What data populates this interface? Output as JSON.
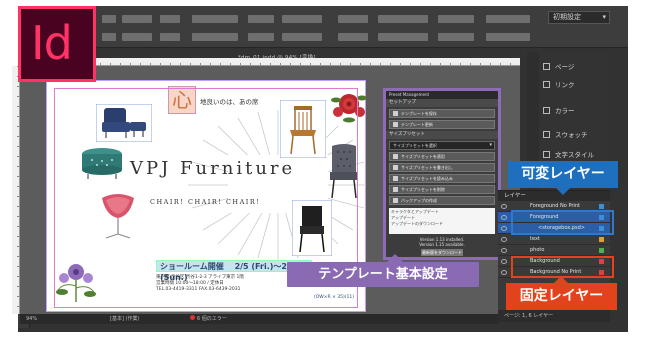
{
  "app": {
    "logo_text": "Id",
    "workspace": "初期設定",
    "doc_tab": "*dm_01.indd @ 94% [変換]",
    "colors": {
      "indesign_pink": "#ff3366",
      "indesign_dark": "#49021f",
      "template_purple": "#8a6bb3",
      "variable_blue": "#1f6fbf",
      "fixed_red": "#e2421c"
    }
  },
  "document": {
    "kokoro": "心",
    "catch_copy": "地良いのは、あの席",
    "heading": "VPJ Furniture",
    "sub_heading": "CHAIR! CHAIR! CHAIR!",
    "showroom_text": "ショールーム開催",
    "showroom_date": "2/5 (Fri.)～2/7 (Sun.)",
    "address_lines": [
      "東京都 渋谷区 渋谷1-2-3 アライブ東京 1階",
      "営業時間 10:00～18:00 / 定休日",
      "TEL.03-4419-3311 FAX.03-6439-2031"
    ],
    "price_note": "(OW×R × 35)(11)"
  },
  "script_panel": {
    "title": "Preset Management",
    "header": "セットアップ",
    "btn_open": "テンプレートを保存",
    "btn_save": "テンプレート更新",
    "section_label": "サイズプリセット",
    "select_value": "サイズプリセットを選択",
    "buttons": [
      "サイズプリセットを適用",
      "サイズプリセットを書き出し",
      "サイズプリセットを読み込み",
      "サイズプリセットを削除",
      "バックアップの作成"
    ],
    "log_lines": [
      "キャラクタとアップデート",
      "アップデート",
      "アップデートのダウンロード"
    ],
    "version_installed": "Version 1.13 installed.",
    "version_available": "Version 1.15 available.",
    "download_label": "最新版をダウンロード"
  },
  "dock": {
    "items": [
      "ページ",
      "リンク",
      "カラー",
      "スウォッチ",
      "文字スタイル"
    ]
  },
  "layers": {
    "title": "レイヤー",
    "rows": [
      {
        "name": "Foreground No Print",
        "sub": false,
        "highlight": false,
        "chip": "#3a8fd8"
      },
      {
        "name": "Foreground",
        "sub": false,
        "highlight": true,
        "chip": "#3a8fd8"
      },
      {
        "name": "<storagebox.psd>",
        "sub": true,
        "highlight": true,
        "chip": "#3a8fd8"
      },
      {
        "name": "text",
        "sub": false,
        "highlight": false,
        "chip": "#e0a030"
      },
      {
        "name": "photo",
        "sub": false,
        "highlight": false,
        "chip": "#50b050"
      },
      {
        "name": "Background",
        "sub": false,
        "highlight": false,
        "chip": "#e04040"
      },
      {
        "name": "Background No Print",
        "sub": false,
        "highlight": false,
        "chip": "#e04040"
      }
    ],
    "footer": "ページ: 1, 6 レイヤー"
  },
  "status": {
    "zoom": "94%",
    "preset": "[基本] (作業)",
    "errors": "6 個のエラー"
  },
  "callouts": {
    "template": "テンプレート基本設定",
    "variable": "可変レイヤー",
    "fixed": "固定レイヤー"
  }
}
